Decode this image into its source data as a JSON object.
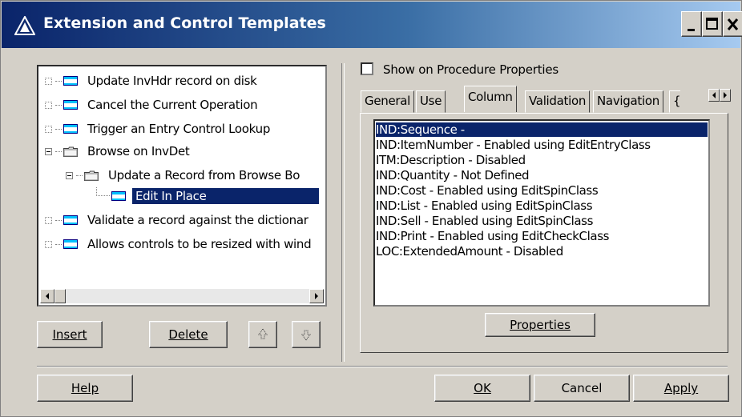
{
  "window": {
    "title": "Extension and Control Templates"
  },
  "tree": {
    "items": [
      {
        "label": "Update InvHdr record on disk",
        "icon": "window-icon",
        "level": 0
      },
      {
        "label": "Cancel the Current Operation",
        "icon": "window-icon",
        "level": 0
      },
      {
        "label": "Trigger an Entry Control Lookup",
        "icon": "window-icon",
        "level": 0
      },
      {
        "label": "Browse on InvDet",
        "icon": "folder-icon",
        "level": 0
      },
      {
        "label": "Update a Record from Browse Bo",
        "icon": "folder-icon",
        "level": 1
      },
      {
        "label": "Edit In Place",
        "icon": "window-icon",
        "level": 2,
        "selected": true
      },
      {
        "label": "Validate a record against the dictionar",
        "icon": "window-icon",
        "level": 0
      },
      {
        "label": "Allows controls to be resized with wind",
        "icon": "window-icon",
        "level": 0
      }
    ]
  },
  "left_buttons": {
    "insert": "Insert",
    "delete": "Delete"
  },
  "show_on_props": {
    "label": "Show on Procedure Properties",
    "checked": false
  },
  "tabs": [
    "General",
    "Use",
    "Column",
    "Validation",
    "Navigation",
    "{"
  ],
  "active_tab": "Column",
  "columns": [
    "IND:Sequence -",
    "IND:ItemNumber - Enabled using EditEntryClass",
    "ITM:Description - Disabled",
    "IND:Quantity - Not Defined",
    "IND:Cost - Enabled using EditSpinClass",
    "IND:List - Enabled using EditSpinClass",
    "IND:Sell - Enabled using EditSpinClass",
    "IND:Print - Enabled using EditCheckClass",
    "LOC:ExtendedAmount - Disabled"
  ],
  "properties_button": "Properties",
  "bottom_buttons": {
    "help": "Help",
    "ok": "OK",
    "cancel": "Cancel",
    "apply": "Apply"
  },
  "colors": {
    "selection": "#0a246a",
    "titlebar": "#0a246a",
    "face": "#d4d0c8"
  }
}
